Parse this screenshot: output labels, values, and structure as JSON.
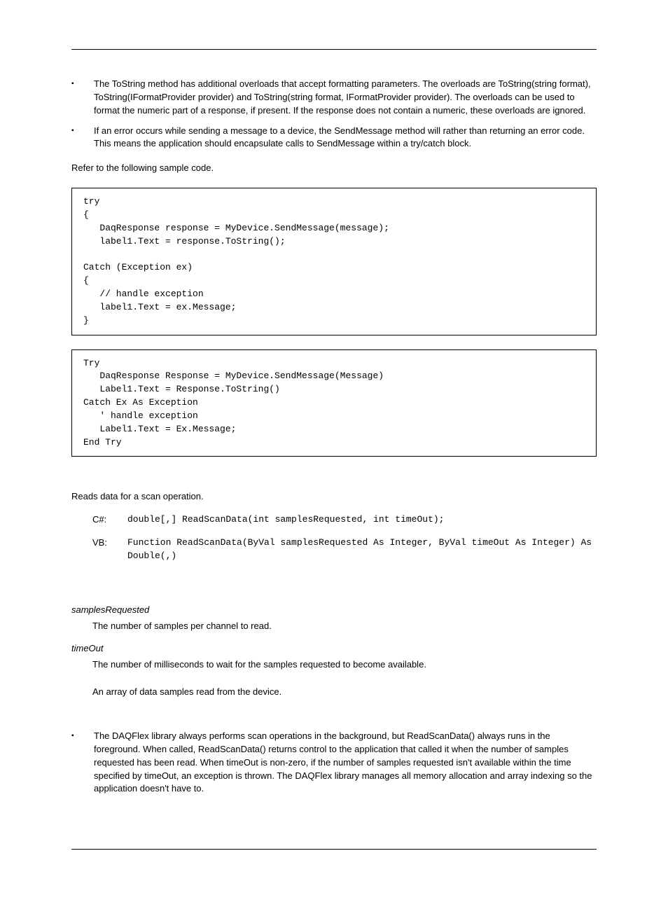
{
  "bullets_top": [
    "The ToString method has additional overloads that accept formatting parameters. The overloads are ToString(string format), ToString(IFormatProvider provider) and ToString(string format, IFormatProvider provider). The overloads can be used to format the numeric part of a response, if present. If the response does not contain a numeric, these overloads are ignored.",
    "If an error occurs while sending a message to a device, the SendMessage method will                 rather than returning an error code. This means the application should encapsulate calls to SendMessage within a try/catch block."
  ],
  "refer_line": "Refer to the following sample code.",
  "code_csharp": "try\n{\n   DaqResponse response = MyDevice.SendMessage(message);\n   label1.Text = response.ToString();\n\nCatch (Exception ex)\n{\n   // handle exception\n   label1.Text = ex.Message;\n}",
  "code_vb": "Try\n   DaqResponse Response = MyDevice.SendMessage(Message)\n   Label1.Text = Response.ToString()\nCatch Ex As Exception\n   ' handle exception\n   Label1.Text = Ex.Message;\nEnd Try",
  "readscan_desc": "Reads data for a scan operation.",
  "sig_csharp_label": "C#:",
  "sig_csharp": "double[,] ReadScanData(int samplesRequested, int timeOut);",
  "sig_vb_label": "VB:",
  "sig_vb": "Function ReadScanData(ByVal samplesRequested As Integer, ByVal timeOut As Integer) As Double(,)",
  "param1_name": "samplesRequested",
  "param1_desc": "The number of samples per channel to read.",
  "param2_name": "timeOut",
  "param2_desc": "The number of milliseconds to wait for the samples requested to become available.",
  "return_desc": "An array of data samples read from the device.",
  "bullets_bottom": [
    "The DAQFlex library always performs scan operations in the background, but ReadScanData() always runs in the foreground. When called, ReadScanData() returns control to the application that called it when the number of samples requested has been read. When timeOut is non-zero, if the number of samples requested isn't available within the time specified by timeOut, an exception is thrown. The DAQFlex library manages all memory allocation and array indexing so the application doesn't have to."
  ]
}
